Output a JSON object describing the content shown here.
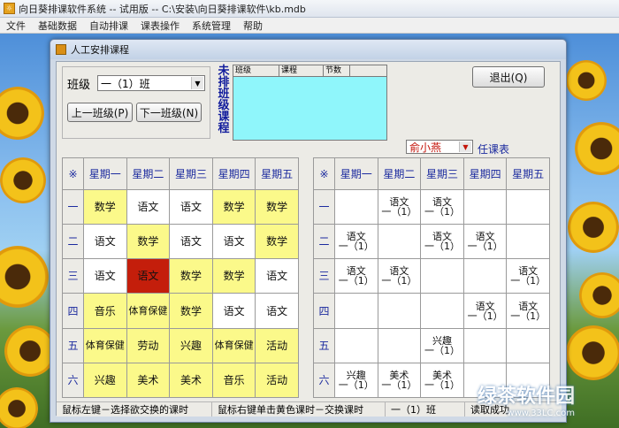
{
  "app": {
    "title": "向日葵排课软件系统 -- 试用版  -- C:\\安装\\向日葵排课软件\\kb.mdb",
    "menu": [
      "文件",
      "基础数据",
      "自动排课",
      "课表操作",
      "系统管理",
      "帮助"
    ]
  },
  "dialog": {
    "title": "人工安排课程",
    "class_label": "班级",
    "class_value": "一（1）班",
    "prev_class": "上一班级(P)",
    "next_class": "下一班级(N)",
    "exit": "退出(Q)",
    "unarranged_label": "未排班级课程",
    "unarranged_headers": [
      "班级",
      "课程",
      "节数"
    ],
    "teacher_value": "俞小燕",
    "teacher_label": "任课表"
  },
  "class_table": {
    "corner": "※",
    "days": [
      "星期一",
      "星期二",
      "星期三",
      "星期四",
      "星期五"
    ],
    "periods": [
      "一",
      "二",
      "三",
      "四",
      "五",
      "六"
    ],
    "cells": [
      [
        {
          "t": "数学",
          "c": "y"
        },
        {
          "t": "语文",
          "c": "w"
        },
        {
          "t": "语文",
          "c": "w"
        },
        {
          "t": "数学",
          "c": "y"
        },
        {
          "t": "数学",
          "c": "y"
        }
      ],
      [
        {
          "t": "语文",
          "c": "w"
        },
        {
          "t": "数学",
          "c": "y"
        },
        {
          "t": "语文",
          "c": "w"
        },
        {
          "t": "语文",
          "c": "w"
        },
        {
          "t": "数学",
          "c": "y"
        }
      ],
      [
        {
          "t": "语文",
          "c": "w"
        },
        {
          "t": "语文",
          "c": "r"
        },
        {
          "t": "数学",
          "c": "y"
        },
        {
          "t": "数学",
          "c": "y"
        },
        {
          "t": "语文",
          "c": "w"
        }
      ],
      [
        {
          "t": "音乐",
          "c": "y"
        },
        {
          "t": "体育保健",
          "c": "y"
        },
        {
          "t": "数学",
          "c": "y"
        },
        {
          "t": "语文",
          "c": "w"
        },
        {
          "t": "语文",
          "c": "w"
        }
      ],
      [
        {
          "t": "体育保健",
          "c": "y"
        },
        {
          "t": "劳动",
          "c": "y"
        },
        {
          "t": "兴趣",
          "c": "y"
        },
        {
          "t": "体育保健",
          "c": "y"
        },
        {
          "t": "活动",
          "c": "y"
        }
      ],
      [
        {
          "t": "兴趣",
          "c": "y"
        },
        {
          "t": "美术",
          "c": "y"
        },
        {
          "t": "美术",
          "c": "y"
        },
        {
          "t": "音乐",
          "c": "y"
        },
        {
          "t": "活动",
          "c": "y"
        }
      ]
    ]
  },
  "teacher_table": {
    "corner": "※",
    "days": [
      "星期一",
      "星期二",
      "星期三",
      "星期四",
      "星期五"
    ],
    "periods": [
      "一",
      "二",
      "三",
      "四",
      "五",
      "六"
    ],
    "cells": [
      [
        "",
        "语文|一（1）",
        "语文|一（1）",
        "",
        ""
      ],
      [
        "语文|一（1）",
        "",
        "语文|一（1）",
        "语文|一（1）",
        ""
      ],
      [
        "语文|一（1）",
        "语文|一（1）",
        "",
        "",
        "语文|一（1）"
      ],
      [
        "",
        "",
        "",
        "语文|一（1）",
        "语文|一（1）"
      ],
      [
        "",
        "",
        "兴趣|一（1）",
        "",
        ""
      ],
      [
        "兴趣|一（1）",
        "美术|一（1）",
        "美术|一（1）",
        "",
        ""
      ]
    ]
  },
  "status": {
    "hint_left": "鼠标左键－选择欲交换的课时",
    "hint_right": "鼠标右键单击黄色课时－交换课时",
    "class": "一（1）班",
    "extra": "读取成功"
  },
  "watermark": {
    "brand": "绿茶软件园",
    "url": "www.33LC.com"
  }
}
